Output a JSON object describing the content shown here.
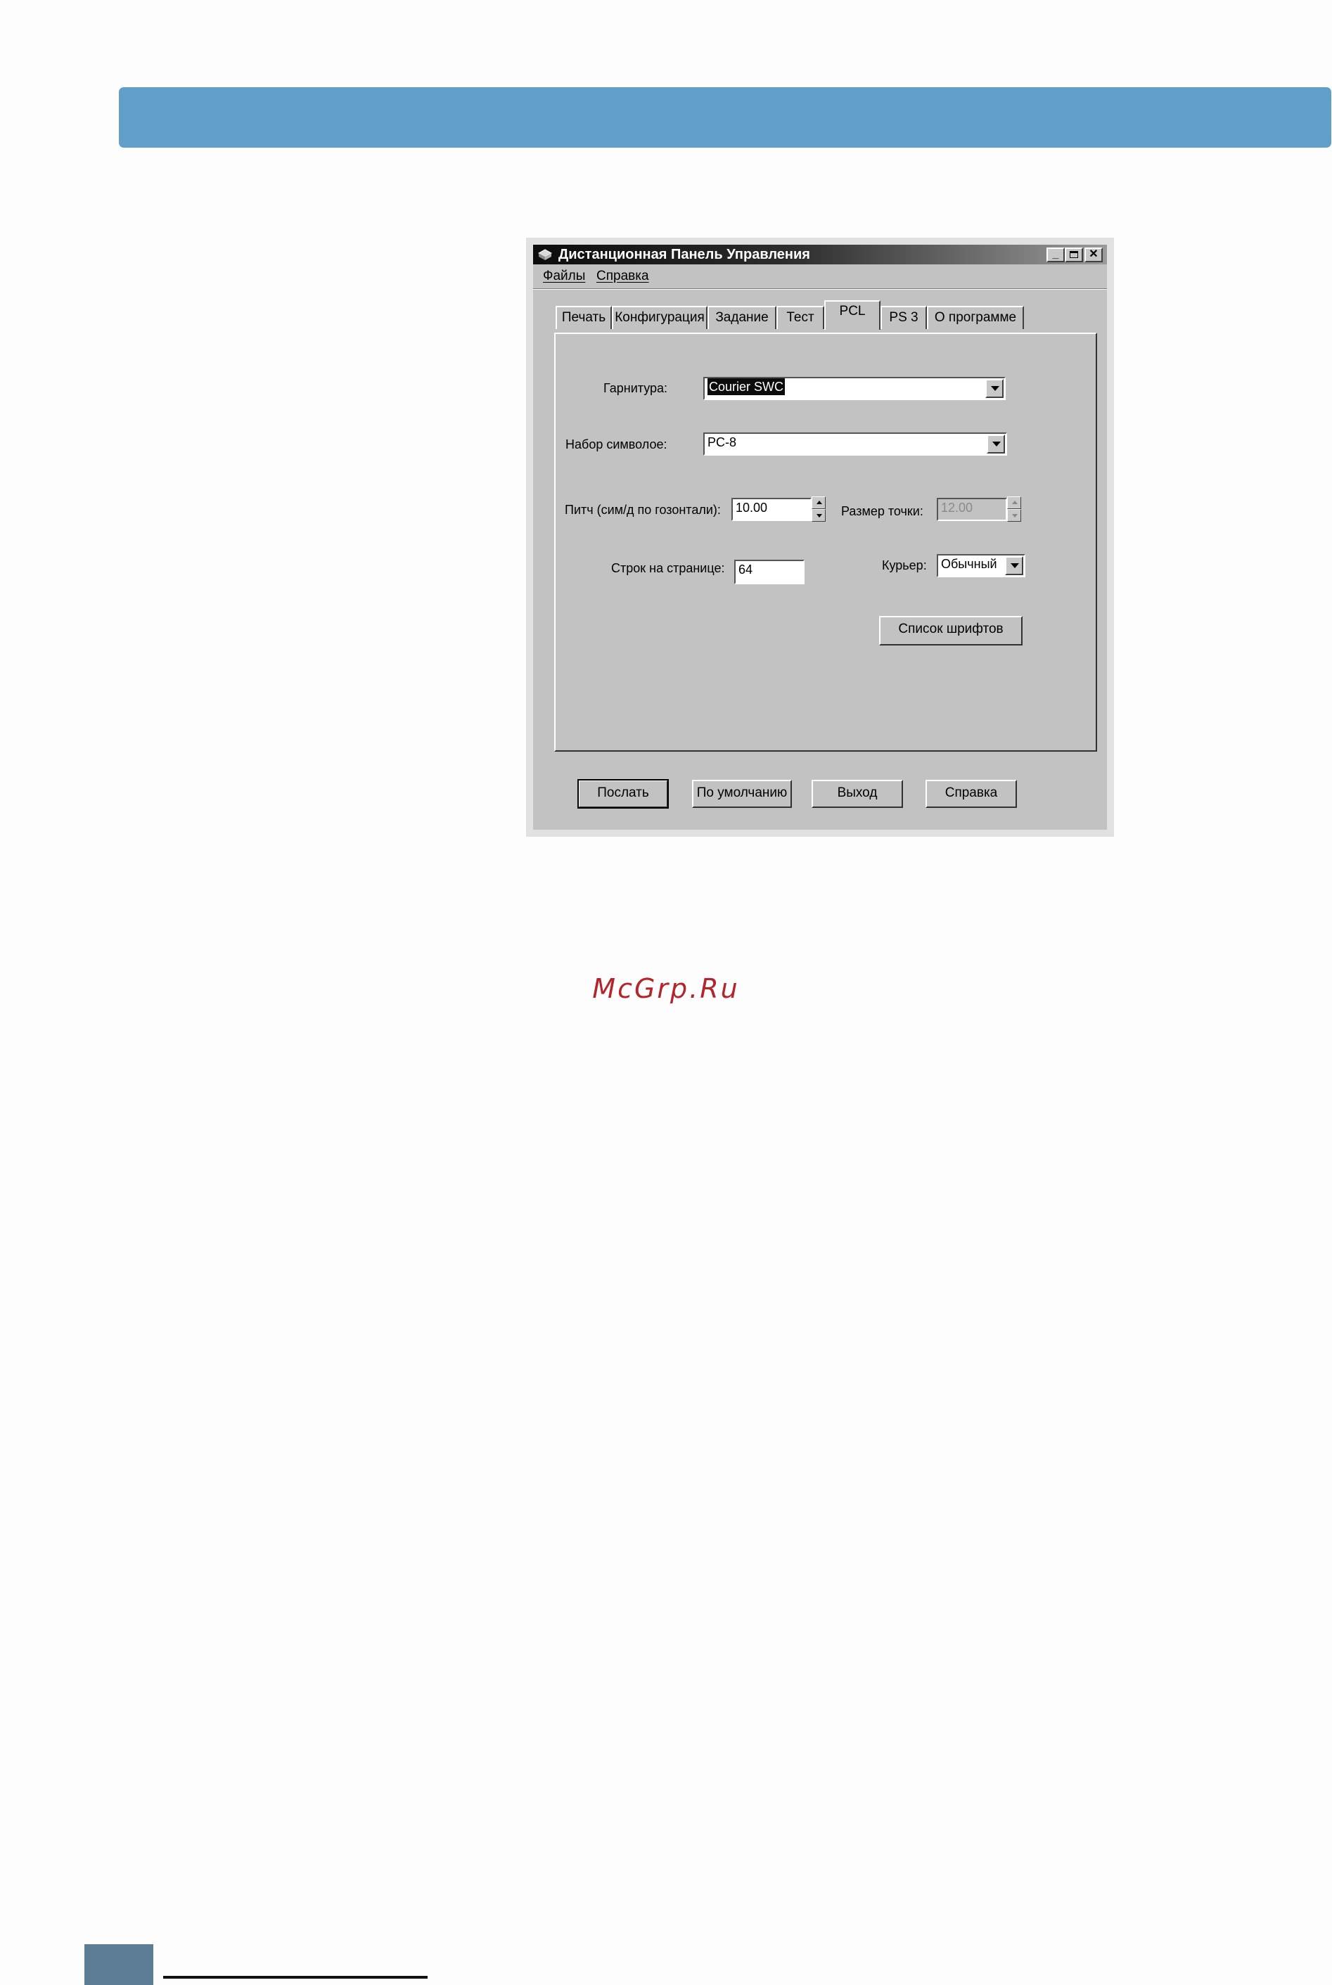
{
  "window": {
    "title": "Дистанционная Панель Управления",
    "minimize": "_",
    "close": "✕"
  },
  "menu": [
    "Файлы",
    "Справка"
  ],
  "tabs": [
    "Печать",
    "Конфигурация",
    "Задание",
    "Тест",
    "PCL",
    "PS 3",
    "О программе"
  ],
  "active_tab": "PCL",
  "form": {
    "typeface_label": "Гарнитура:",
    "typeface_value": "Courier SWC",
    "symbolset_label": "Набор символое:",
    "symbolset_value": "PC-8",
    "pitch_label": "Питч (сим/д по гозонтали):",
    "pitch_value": "10.00",
    "pointsize_label": "Размер точки:",
    "pointsize_value": "12.00",
    "lines_label": "Строк на странице:",
    "lines_value": "64",
    "courier_label": "Курьер:",
    "courier_value": "Обычный",
    "fontlist_button": "Список шрифтов"
  },
  "buttons": {
    "send": "Послать",
    "default": "По умолчанию",
    "exit": "Выход",
    "help": "Справка"
  },
  "watermark": "McGrp.Ru"
}
